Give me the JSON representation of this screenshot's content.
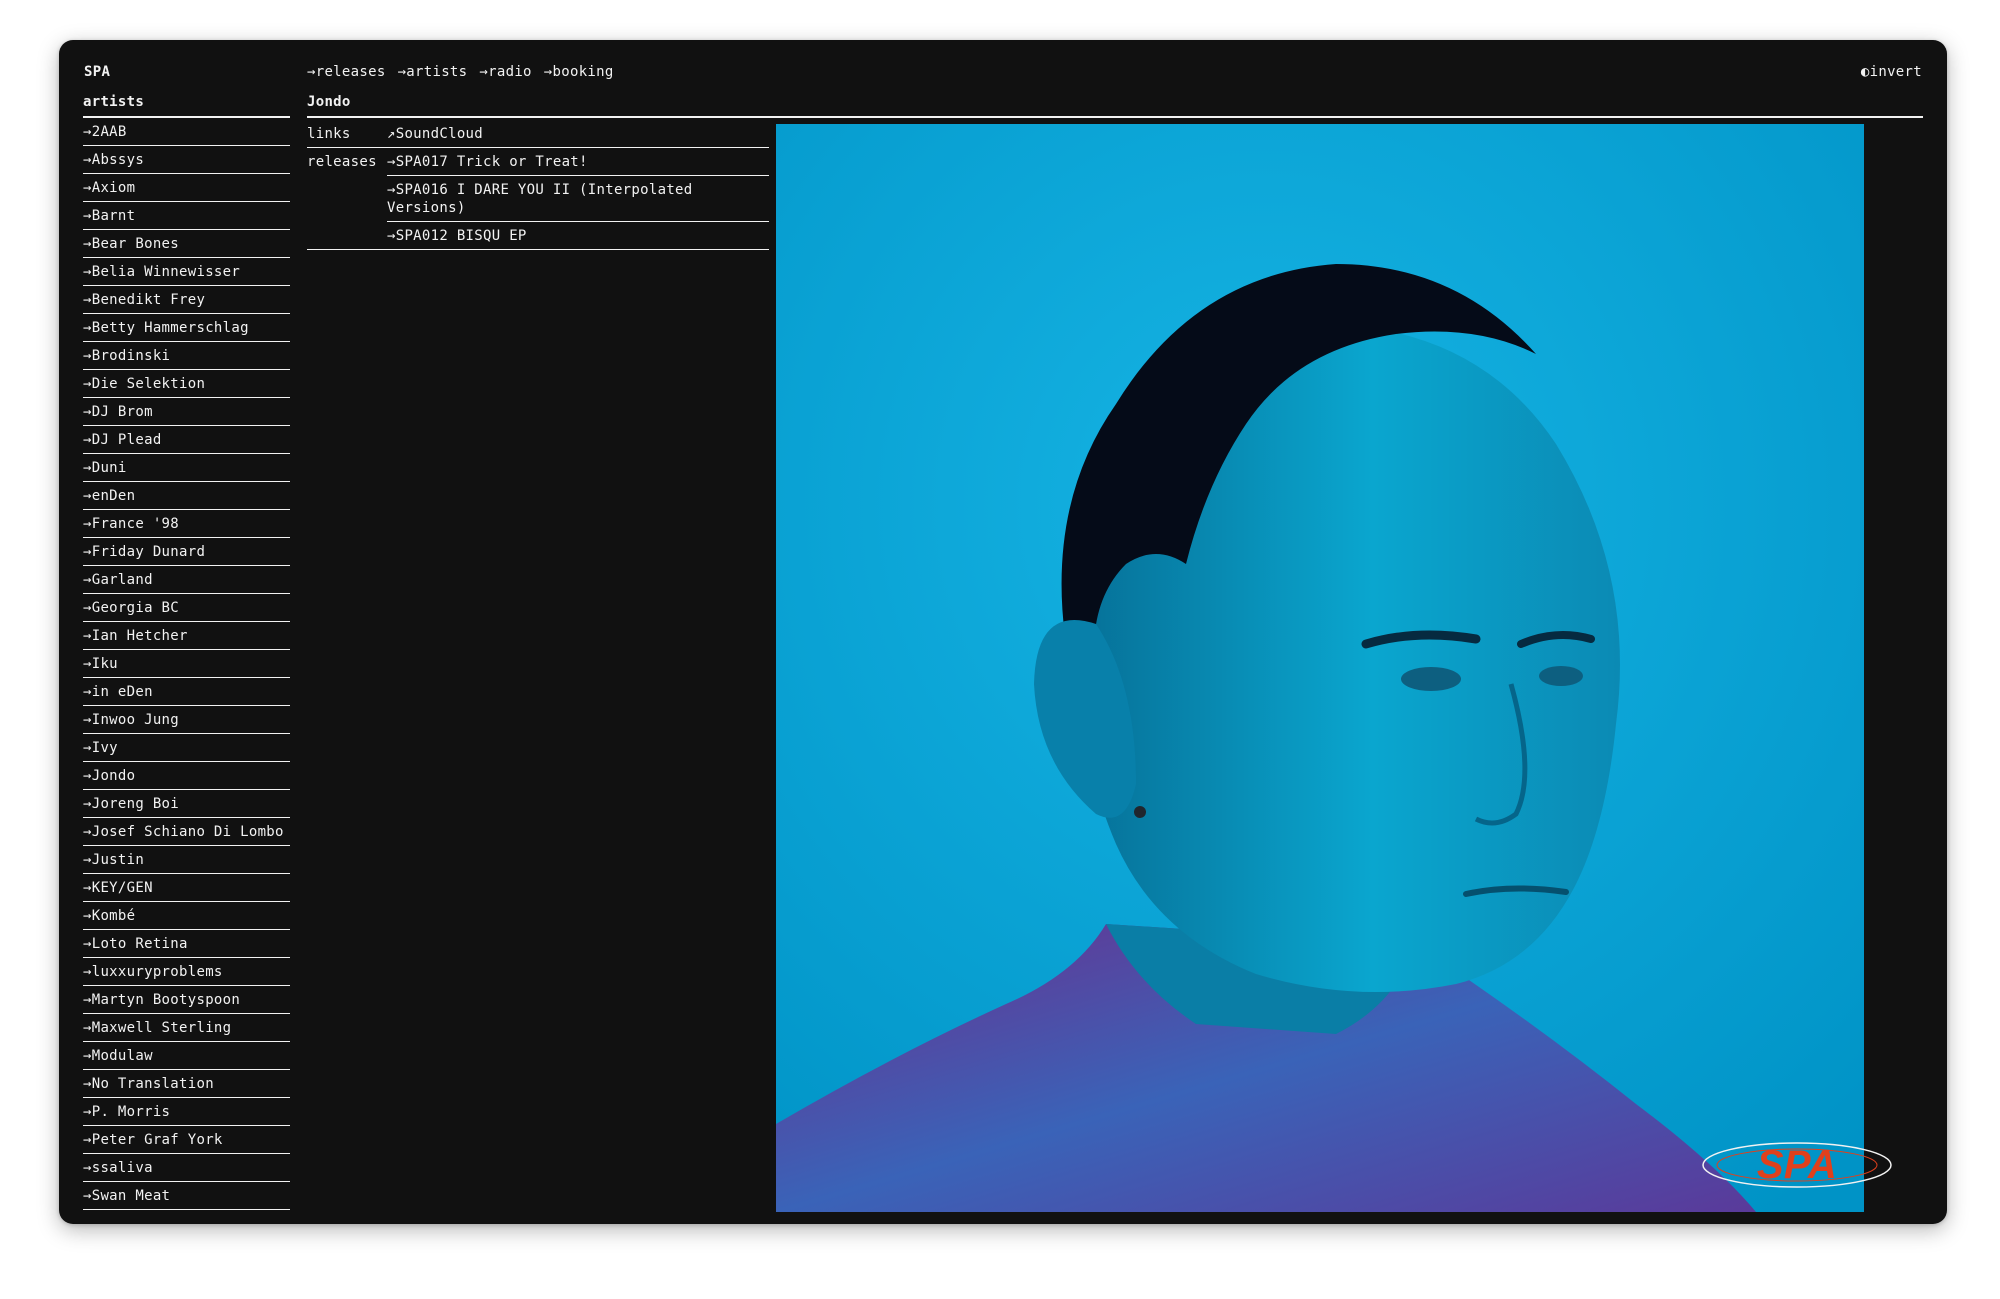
{
  "brand": "SPA",
  "nav": [
    "→releases",
    "→artists",
    "→radio",
    "→booking"
  ],
  "invert_label": "◐invert",
  "sidebar": {
    "heading": "artists",
    "items": [
      "→2AAB",
      "→Abssys",
      "→Axiom",
      "→Barnt",
      "→Bear Bones",
      "→Belia Winnewisser",
      "→Benedikt Frey",
      "→Betty Hammerschlag",
      "→Brodinski",
      "→Die Selektion",
      "→DJ Brom",
      "→DJ Plead",
      "→Duni",
      "→enDen",
      "→France '98",
      "→Friday Dunard",
      "→Garland",
      "→Georgia BC",
      "→Ian Hetcher",
      "→Iku",
      "→in eDen",
      "→Inwoo Jung",
      "→Ivy",
      "→Jondo",
      "→Joreng Boi",
      "→Josef Schiano Di Lombo",
      "→Justin",
      "→KEY/GEN",
      "→Kombé",
      "→Loto Retina",
      "→luxxuryproblems",
      "→Martyn Bootyspoon",
      "→Maxwell Sterling",
      "→Modulaw",
      "→No Translation",
      "→P. Morris",
      "→Peter Graf York",
      "→ssaliva",
      "→Swan Meat"
    ]
  },
  "artist": {
    "name": "Jondo",
    "links_label": "links",
    "links": [
      "↗SoundCloud"
    ],
    "releases_label": "releases",
    "releases": [
      "→SPA017 Trick or Treat!",
      "→SPA016 I DARE YOU II (Interpolated Versions)",
      "→SPA012 BISQU EP"
    ]
  },
  "logo_text": "SPA",
  "colors": {
    "background": "#111111",
    "text": "#f2f2f2",
    "photo_blue": "#00a8d8",
    "logo_red": "#e0401c"
  }
}
